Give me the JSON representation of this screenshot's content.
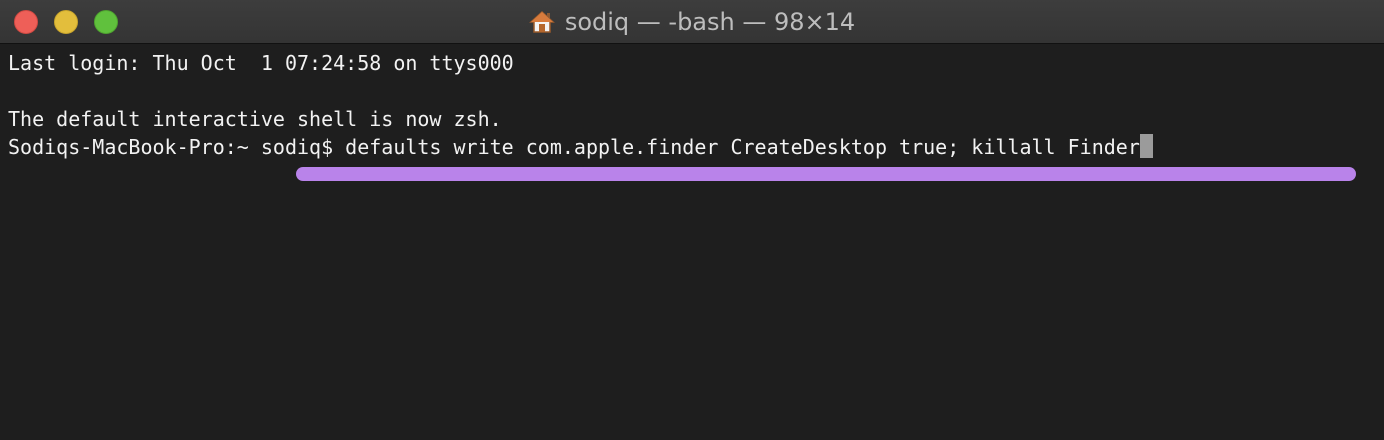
{
  "window": {
    "title": "sodiq — -bash — 98×14",
    "title_icon": "home-icon"
  },
  "terminal": {
    "lines": [
      "Last login: Thu Oct  1 07:24:58 on ttys000",
      "",
      "The default interactive shell is now zsh.",
      "Sodiqs-MacBook-Pro:~ sodiq$ defaults write com.apple.finder CreateDesktop true; killall Finder"
    ]
  },
  "colors": {
    "background": "#1e1e1e",
    "text": "#f2f2f2",
    "highlight": "#b983ea",
    "close": "#ee5f58",
    "minimize": "#e3be3c",
    "zoom": "#60c13d"
  }
}
